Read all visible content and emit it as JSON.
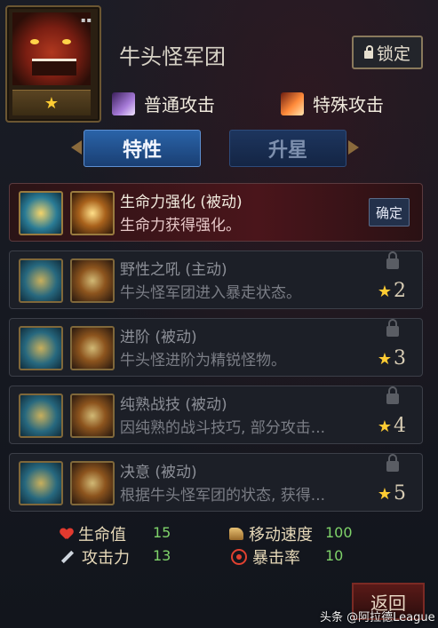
{
  "hero": {
    "name": "牛头怪军团",
    "star_count": 1,
    "star_glyph": "★",
    "portrait_dots": "▪▪"
  },
  "lock_button": {
    "label": "锁定"
  },
  "attacks": {
    "normal": {
      "label": "普通攻击",
      "icon": "purple-slash-icon"
    },
    "special": {
      "label": "特殊攻击",
      "icon": "fire-slash-icon"
    }
  },
  "tabs": {
    "traits": "特性",
    "star_up": "升星"
  },
  "skills": [
    {
      "name": "生命力强化 (被动)",
      "desc": "生命力获得强化。",
      "state": "active",
      "button": "确定"
    },
    {
      "name": "野性之吼 (主动)",
      "desc": "牛头怪军团进入暴走状态。",
      "state": "locked",
      "level": "2"
    },
    {
      "name": "进阶 (被动)",
      "desc": "牛头怪进阶为精锐怪物。",
      "state": "locked",
      "level": "3"
    },
    {
      "name": "纯熟战技 (被动)",
      "desc": "因纯熟的战斗技巧, 部分攻击...",
      "state": "locked",
      "level": "4"
    },
    {
      "name": "决意 (被动)",
      "desc": "根据牛头怪军团的状态, 获得...",
      "state": "locked",
      "level": "5"
    }
  ],
  "stats": {
    "hp": {
      "label": "生命值",
      "value": "15"
    },
    "attack": {
      "label": "攻击力",
      "value": "13"
    },
    "move_speed": {
      "label": "移动速度",
      "value": "100"
    },
    "crit_rate": {
      "label": "暴击率",
      "value": "10"
    }
  },
  "return_button": {
    "label": "返回"
  },
  "watermark": "头条 @阿拉德League",
  "colors": {
    "accent_blue": "#2a63a8",
    "stat_value_green": "#7fd36a",
    "star_gold": "#ffcc33"
  }
}
